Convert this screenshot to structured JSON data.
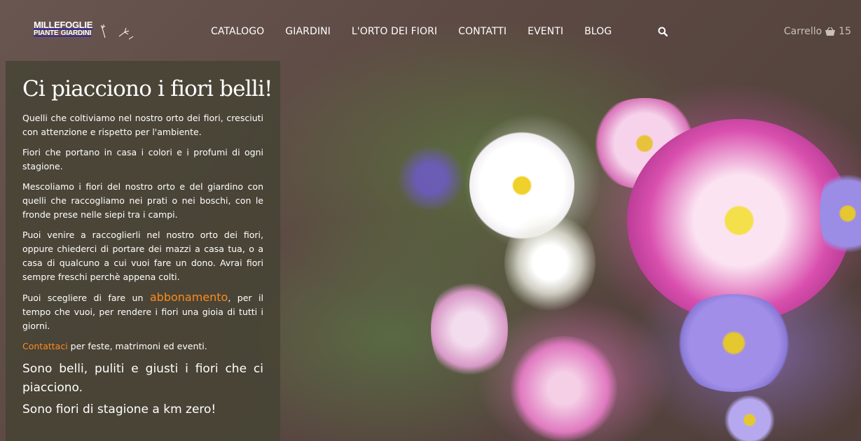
{
  "brand": {
    "logo_top": "MILLEFOGLIE",
    "logo_left": "PIANTE",
    "logo_right": "GIARDINI"
  },
  "nav": {
    "items": [
      "CATALOGO",
      "GIARDINI",
      "L'ORTO DEI FIORI",
      "CONTATTI",
      "EVENTI",
      "BLOG"
    ],
    "search_icon": "search-icon"
  },
  "cart": {
    "label": "Carrello",
    "count": "15",
    "icon": "basket-icon"
  },
  "panel": {
    "title": "Ci piacciono i fiori belli!",
    "p1": "Quelli che coltiviamo nel nostro orto dei fiori, cresciuti con attenzione e rispetto per l'ambiente.",
    "p2": "Fiori che portano in casa i colori e i profumi di ogni stagione.",
    "p3": "Mescoliamo i fiori del nostro orto e del giardino con quelli che raccogliamo nei prati o nei boschi, con le fronde prese nelle siepi tra i campi.",
    "p4": "Puoi venire a raccoglierli nel nostro orto dei fiori, oppure chiederci di portare dei mazzi a casa tua, o a casa di qualcuno a cui vuoi fare un dono. Avrai fiori sempre freschi perchè appena colti.",
    "p5_before": "Puoi scegliere di fare un ",
    "p5_link": "abbonamento",
    "p5_after": ", per il tempo che vuoi, per rendere i fiori una gioia di tutti i giorni.",
    "p6_link": "Contattaci",
    "p6_after": " per feste, matrimoni ed eventi.",
    "lead1": "Sono belli, puliti e giusti i fiori che ci piacciono.",
    "lead2": "Sono fiori di stagione a km zero!"
  },
  "colors": {
    "accent": "#ff8a1c",
    "panel_bg": "#464434",
    "cart_text": "#c8c1b8",
    "logo_red": "#d8311b"
  }
}
